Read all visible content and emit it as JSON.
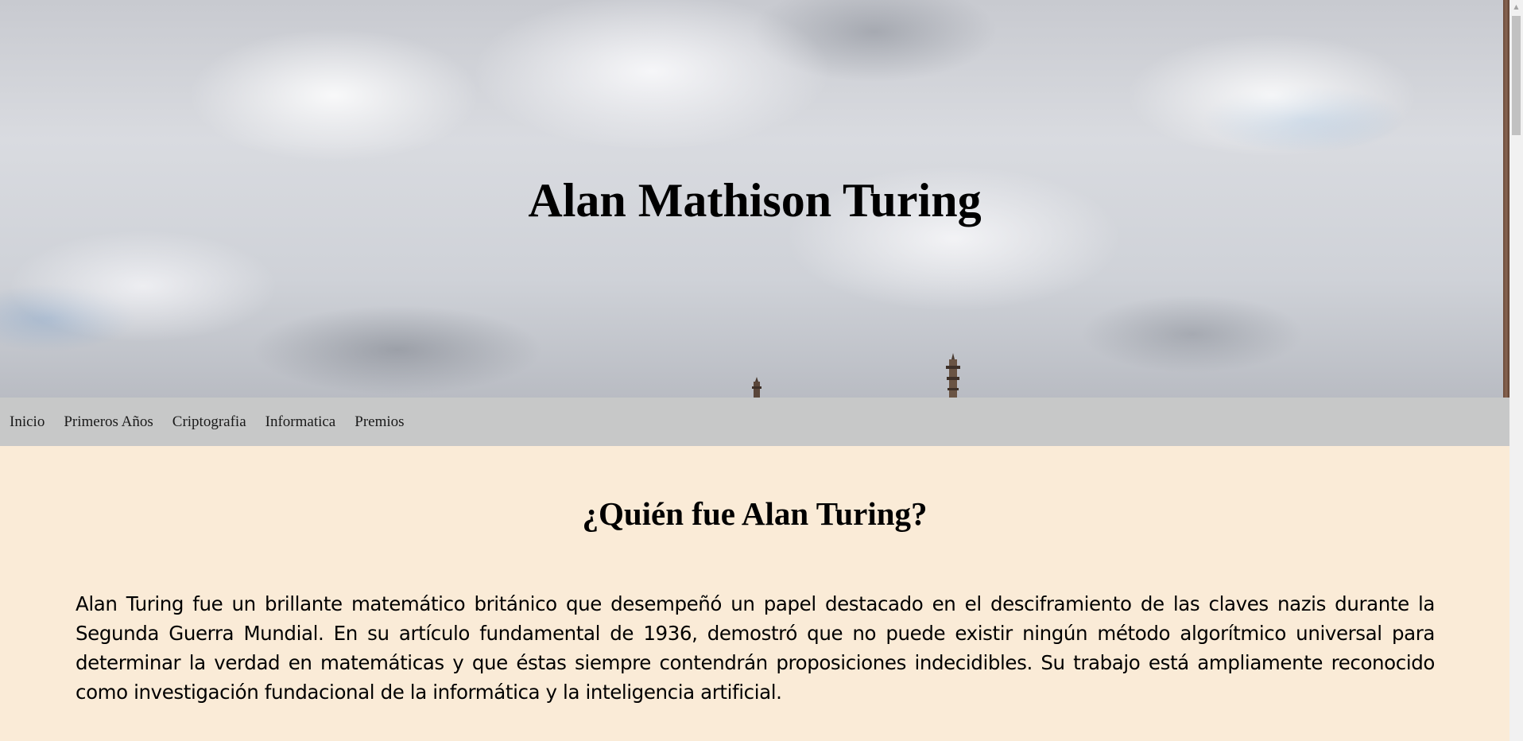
{
  "hero": {
    "title": "Alan Mathison Turing"
  },
  "nav": {
    "items": [
      {
        "label": "Inicio"
      },
      {
        "label": "Primeros Años"
      },
      {
        "label": "Criptografia"
      },
      {
        "label": "Informatica"
      },
      {
        "label": "Premios"
      }
    ]
  },
  "main": {
    "heading": "¿Quién fue Alan Turing?",
    "paragraph": "Alan Turing fue un brillante matemático británico que desempeñó un papel destacado en el desciframiento de las claves nazis durante la Segunda Guerra Mundial. En su artículo fundamental de 1936, demostró que no puede existir ningún método algorítmico universal para determinar la verdad en matemáticas y que éstas siempre contendrán proposiciones indecidibles. Su trabajo está ampliamente reconocido como investigación fundacional de la informática y la inteligencia artificial."
  },
  "colors": {
    "nav_background": "#c7c8c8",
    "content_background": "#faebd7",
    "text": "#000000"
  },
  "icons": {
    "scroll_up": "scroll-up-arrow-icon"
  }
}
